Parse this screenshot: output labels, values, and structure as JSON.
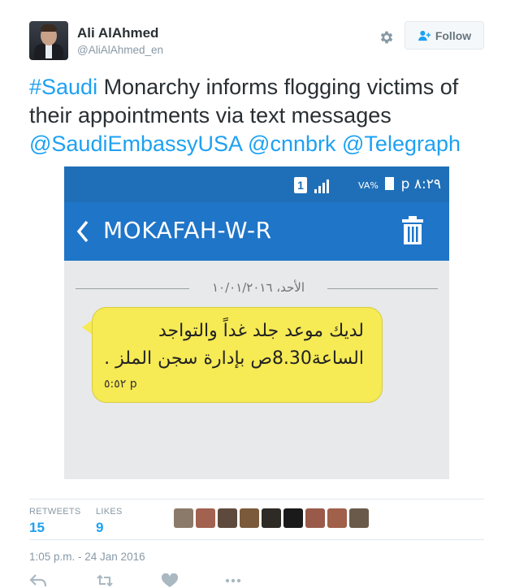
{
  "author": {
    "name": "Ali AlAhmed",
    "handle": "@AliAlAhmed_en",
    "follow_label": "Follow"
  },
  "tweet": {
    "hashtag": "#Saudi",
    "body": " Monarchy informs flogging victims of their appointments via text messages ",
    "mentions": [
      "@SaudiEmbassyUSA",
      "@cnnbrk",
      "@Telegraph"
    ]
  },
  "media": {
    "status_bar": {
      "sim_number": "1",
      "network": "VA%",
      "time": "p ٨:٢٩"
    },
    "contact_name": "MOKAFAH-W-R",
    "date_separator": "الأحد، ١٠/٠١/٢٠١٦",
    "message": {
      "line1": "لديك موعد جلد غداً والتواجد",
      "line2": "الساعة8.30ص بإدارة سجن الملز .",
      "time": "p ٥:٥٢"
    }
  },
  "stats": {
    "retweets_label": "RETWEETS",
    "retweets_value": "15",
    "likes_label": "LIKES",
    "likes_value": "9"
  },
  "liker_colors": [
    "#8b7a6a",
    "#a3614f",
    "#5e4a3c",
    "#7a5a3a",
    "#2e2a26",
    "#1a1a1a",
    "#9a5a4a",
    "#a0604a",
    "#6a5a4a"
  ],
  "timestamp": "1:05 p.m. - 24 Jan 2016",
  "actions": [
    "reply-icon",
    "retweet-icon",
    "like-icon",
    "more-icon"
  ],
  "colors": {
    "link": "#1da1f2",
    "phone_bar": "#1f75c8",
    "bubble": "#f6ea55"
  }
}
